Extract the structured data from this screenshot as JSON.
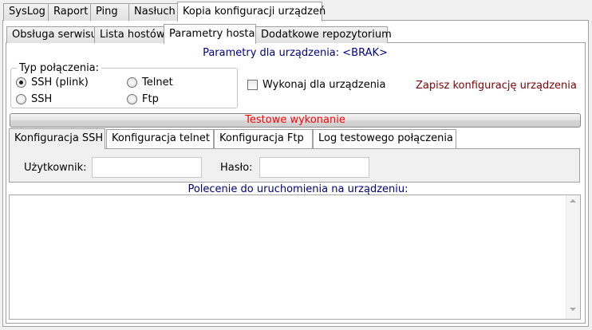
{
  "main_tabs": [
    {
      "label": "SysLog"
    },
    {
      "label": "Raport"
    },
    {
      "label": "Ping"
    },
    {
      "label": "Nasłuch"
    },
    {
      "label": "Kopia konfiguracji urządzeń"
    }
  ],
  "sub_tabs": [
    {
      "label": "Obsługa serwisu"
    },
    {
      "label": "Lista hostów"
    },
    {
      "label": "Parametry hosta"
    },
    {
      "label": "Dodatkowe repozytorium"
    }
  ],
  "host_params": {
    "header": "Parametry dla urządzenia: <BRAK>",
    "connection_group_label": "Typ połączenia:",
    "radios": [
      {
        "label": "SSH (plink)",
        "selected": true
      },
      {
        "label": "SSH",
        "selected": false
      },
      {
        "label": "Telnet",
        "selected": false
      },
      {
        "label": "Ftp",
        "selected": false
      }
    ],
    "execute_checkbox_label": "Wykonaj dla urządzenia",
    "save_config_link": "Zapisz konfigurację urządzenia",
    "test_button_label": "Testowe wykonanie"
  },
  "config_tabs": [
    {
      "label": "Konfiguracja SSH"
    },
    {
      "label": "Konfiguracja telnet"
    },
    {
      "label": "Konfiguracja Ftp"
    },
    {
      "label": "Log testowego połączenia"
    }
  ],
  "ssh_config": {
    "user_label": "Użytkownik:",
    "user_value": "",
    "password_label": "Hasło:",
    "password_value": "",
    "command_label": "Polecenie do uruchomienia na urządzeniu:",
    "command_value": ""
  },
  "colors": {
    "header_blue": "#000080",
    "save_link": "#800000",
    "test_button_text": "#ff0000"
  }
}
